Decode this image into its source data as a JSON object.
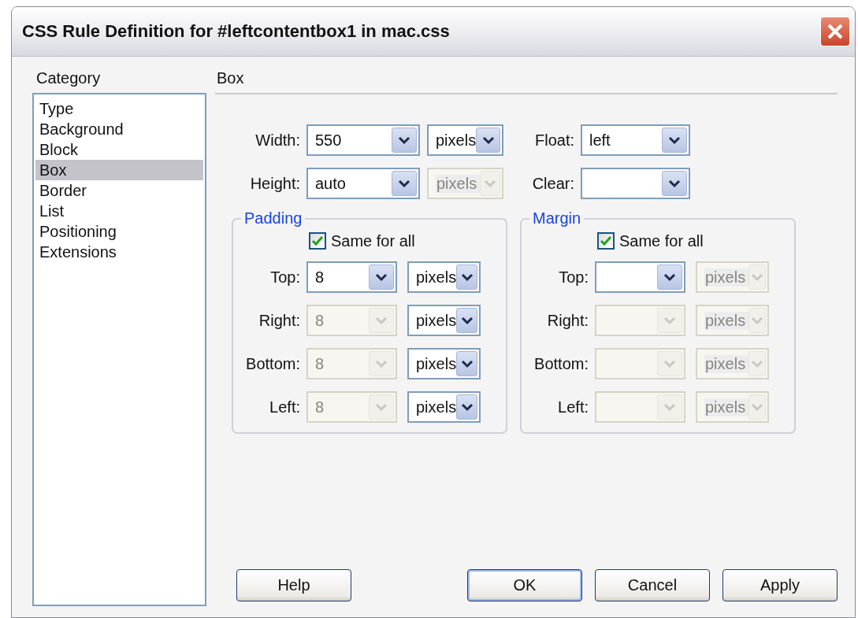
{
  "window": {
    "title": "CSS Rule Definition for #leftcontentbox1 in mac.css"
  },
  "category": {
    "label": "Category",
    "items": [
      {
        "label": "Type",
        "selected": false
      },
      {
        "label": "Background",
        "selected": false
      },
      {
        "label": "Block",
        "selected": false
      },
      {
        "label": "Box",
        "selected": true
      },
      {
        "label": "Border",
        "selected": false
      },
      {
        "label": "List",
        "selected": false
      },
      {
        "label": "Positioning",
        "selected": false
      },
      {
        "label": "Extensions",
        "selected": false
      }
    ]
  },
  "panel": {
    "title": "Box"
  },
  "fields": [
    {
      "kind": "measure",
      "label": "Width:",
      "value": "550",
      "disabled": false,
      "unit": {
        "value": "pixels",
        "disabled": false
      }
    },
    {
      "kind": "choice",
      "label": "Float:",
      "value": "left",
      "disabled": false
    },
    {
      "kind": "measure",
      "label": "Height:",
      "value": "auto",
      "disabled": false,
      "unit": {
        "value": "pixels",
        "disabled": true
      }
    },
    {
      "kind": "choice",
      "label": "Clear:",
      "disabled": false
    }
  ],
  "groups": [
    {
      "title": "Padding",
      "same_for_all": {
        "label": "Same for all",
        "checked": true
      },
      "rows": [
        {
          "label": "Top:",
          "value": "8",
          "disabled": false,
          "unit": {
            "value": "pixels",
            "disabled": false
          }
        },
        {
          "label": "Right:",
          "value": "8",
          "disabled": true,
          "unit": {
            "value": "pixels",
            "disabled": false
          }
        },
        {
          "label": "Bottom:",
          "value": "8",
          "disabled": true,
          "unit": {
            "value": "pixels",
            "disabled": false
          }
        },
        {
          "label": "Left:",
          "value": "8",
          "disabled": true,
          "unit": {
            "value": "pixels",
            "disabled": false
          }
        }
      ]
    },
    {
      "title": "Margin",
      "same_for_all": {
        "label": "Same for all",
        "checked": true
      },
      "rows": [
        {
          "label": "Top:",
          "disabled": false,
          "unit": {
            "value": "pixels",
            "disabled": true
          }
        },
        {
          "label": "Right:",
          "disabled": true,
          "unit": {
            "value": "pixels",
            "disabled": true
          }
        },
        {
          "label": "Bottom:",
          "disabled": true,
          "unit": {
            "value": "pixels",
            "disabled": true
          }
        },
        {
          "label": "Left:",
          "disabled": true,
          "unit": {
            "value": "pixels",
            "disabled": true
          }
        }
      ]
    }
  ],
  "buttons": [
    {
      "label": "Help",
      "default": false
    },
    {
      "label": "OK",
      "default": true
    },
    {
      "label": "Cancel",
      "default": false
    },
    {
      "label": "Apply",
      "default": false
    }
  ]
}
